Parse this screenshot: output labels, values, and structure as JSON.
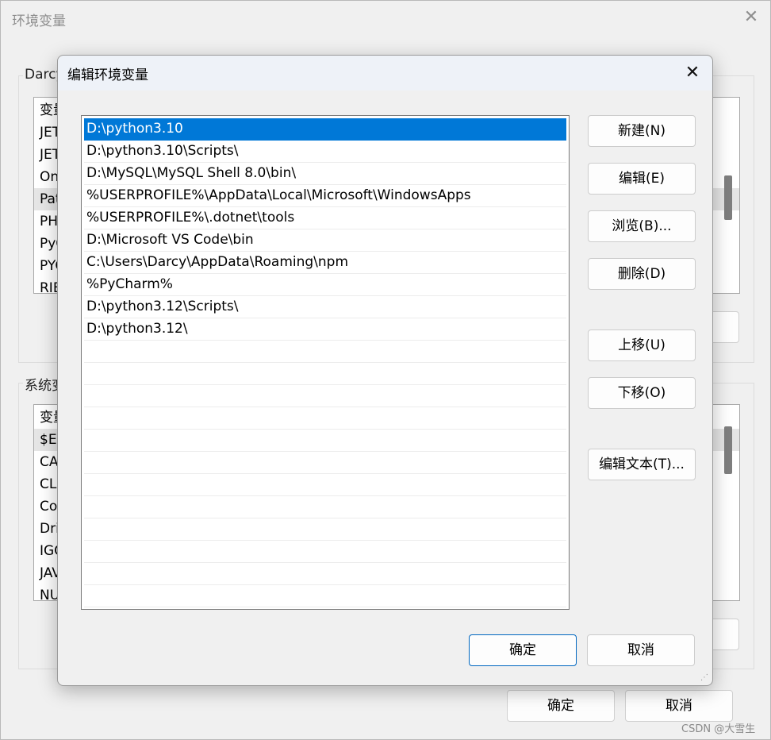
{
  "background_window": {
    "title": "环境变量",
    "close_glyph": "✕",
    "user_group_label": "Darcy",
    "user_list": [
      "变量",
      "JET",
      "JET",
      "On",
      "Pat",
      "PH",
      "PyC",
      "PYC",
      "RIE"
    ],
    "system_group_label": "系统变",
    "system_list": [
      "变量",
      "$EI",
      "CA",
      "CLA",
      "Co",
      "Dri",
      "IGC",
      "JAV",
      "NU"
    ],
    "ok_label": "确定",
    "cancel_label": "取消"
  },
  "dialog": {
    "title": "编辑环境变量",
    "close_glyph": "✕",
    "paths": [
      "D:\\python3.10",
      "D:\\python3.10\\Scripts\\",
      "D:\\MySQL\\MySQL Shell 8.0\\bin\\",
      "%USERPROFILE%\\AppData\\Local\\Microsoft\\WindowsApps",
      "%USERPROFILE%\\.dotnet\\tools",
      "D:\\Microsoft VS Code\\bin",
      "C:\\Users\\Darcy\\AppData\\Roaming\\npm",
      "%PyCharm%",
      "D:\\python3.12\\Scripts\\",
      "D:\\python3.12\\",
      "",
      "",
      "",
      "",
      "",
      "",
      "",
      "",
      "",
      "",
      "",
      ""
    ],
    "selected_index": 0,
    "buttons": {
      "new": "新建(N)",
      "edit": "编辑(E)",
      "browse": "浏览(B)...",
      "delete": "删除(D)",
      "move_up": "上移(U)",
      "move_down": "下移(O)",
      "edit_text": "编辑文本(T)..."
    },
    "ok_label": "确定",
    "cancel_label": "取消",
    "resize_grip_glyph": "⋰"
  },
  "watermark": "CSDN @大雪生",
  "colors": {
    "selection": "#0078d7",
    "primary_border": "#0067c0"
  }
}
